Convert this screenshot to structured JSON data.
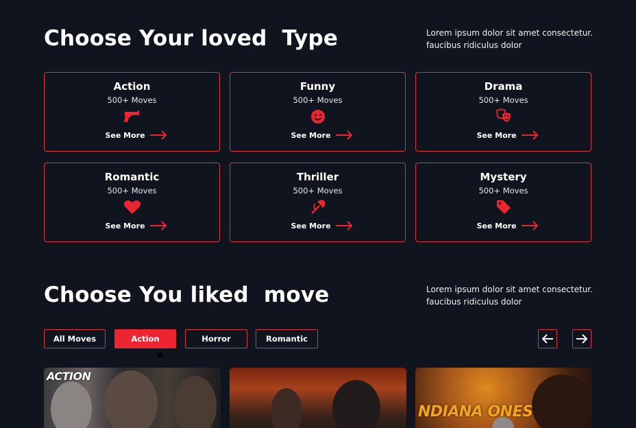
{
  "types_section": {
    "title": "Choose Your loved  Type",
    "description": "Lorem ipsum dolor sit amet consectetur. faucibus ridiculus dolor"
  },
  "categories": [
    {
      "title": "Action",
      "count": "500+ Moves",
      "icon": "gun-icon",
      "link": "See More"
    },
    {
      "title": "Funny",
      "count": "500+ Moves",
      "icon": "smiley-face-icon",
      "link": "See More"
    },
    {
      "title": "Drama",
      "count": "500+ Moves",
      "icon": "theater-masks-icon",
      "link": "See More"
    },
    {
      "title": "Romantic",
      "count": "500+ Moves",
      "icon": "heart-icon",
      "link": "See More"
    },
    {
      "title": "Thriller",
      "count": "500+ Moves",
      "icon": "axe-icon",
      "link": "See More"
    },
    {
      "title": "Mystery",
      "count": "500+ Moves",
      "icon": "tag-icon",
      "link": "See More"
    }
  ],
  "moves_section": {
    "title": "Choose You liked  move",
    "description": "Lorem ipsum dolor sit amet consectetur. faucibus ridiculus dolor"
  },
  "filters": [
    {
      "label": "All Moves",
      "active": false
    },
    {
      "label": "Action",
      "active": true
    },
    {
      "label": "Horror",
      "active": false
    },
    {
      "label": "Romantic",
      "active": false
    }
  ],
  "navigation": {
    "prev_icon": "arrow-left-icon",
    "next_icon": "arrow-right-icon"
  },
  "posters": [
    {
      "label": "ACTION"
    },
    {
      "label": ""
    },
    {
      "label": "NDIANA ONES"
    }
  ],
  "colors": {
    "background": "#10141e",
    "accent": "#e0323c",
    "active_fill": "#ec2530",
    "text": "#ffffff"
  }
}
